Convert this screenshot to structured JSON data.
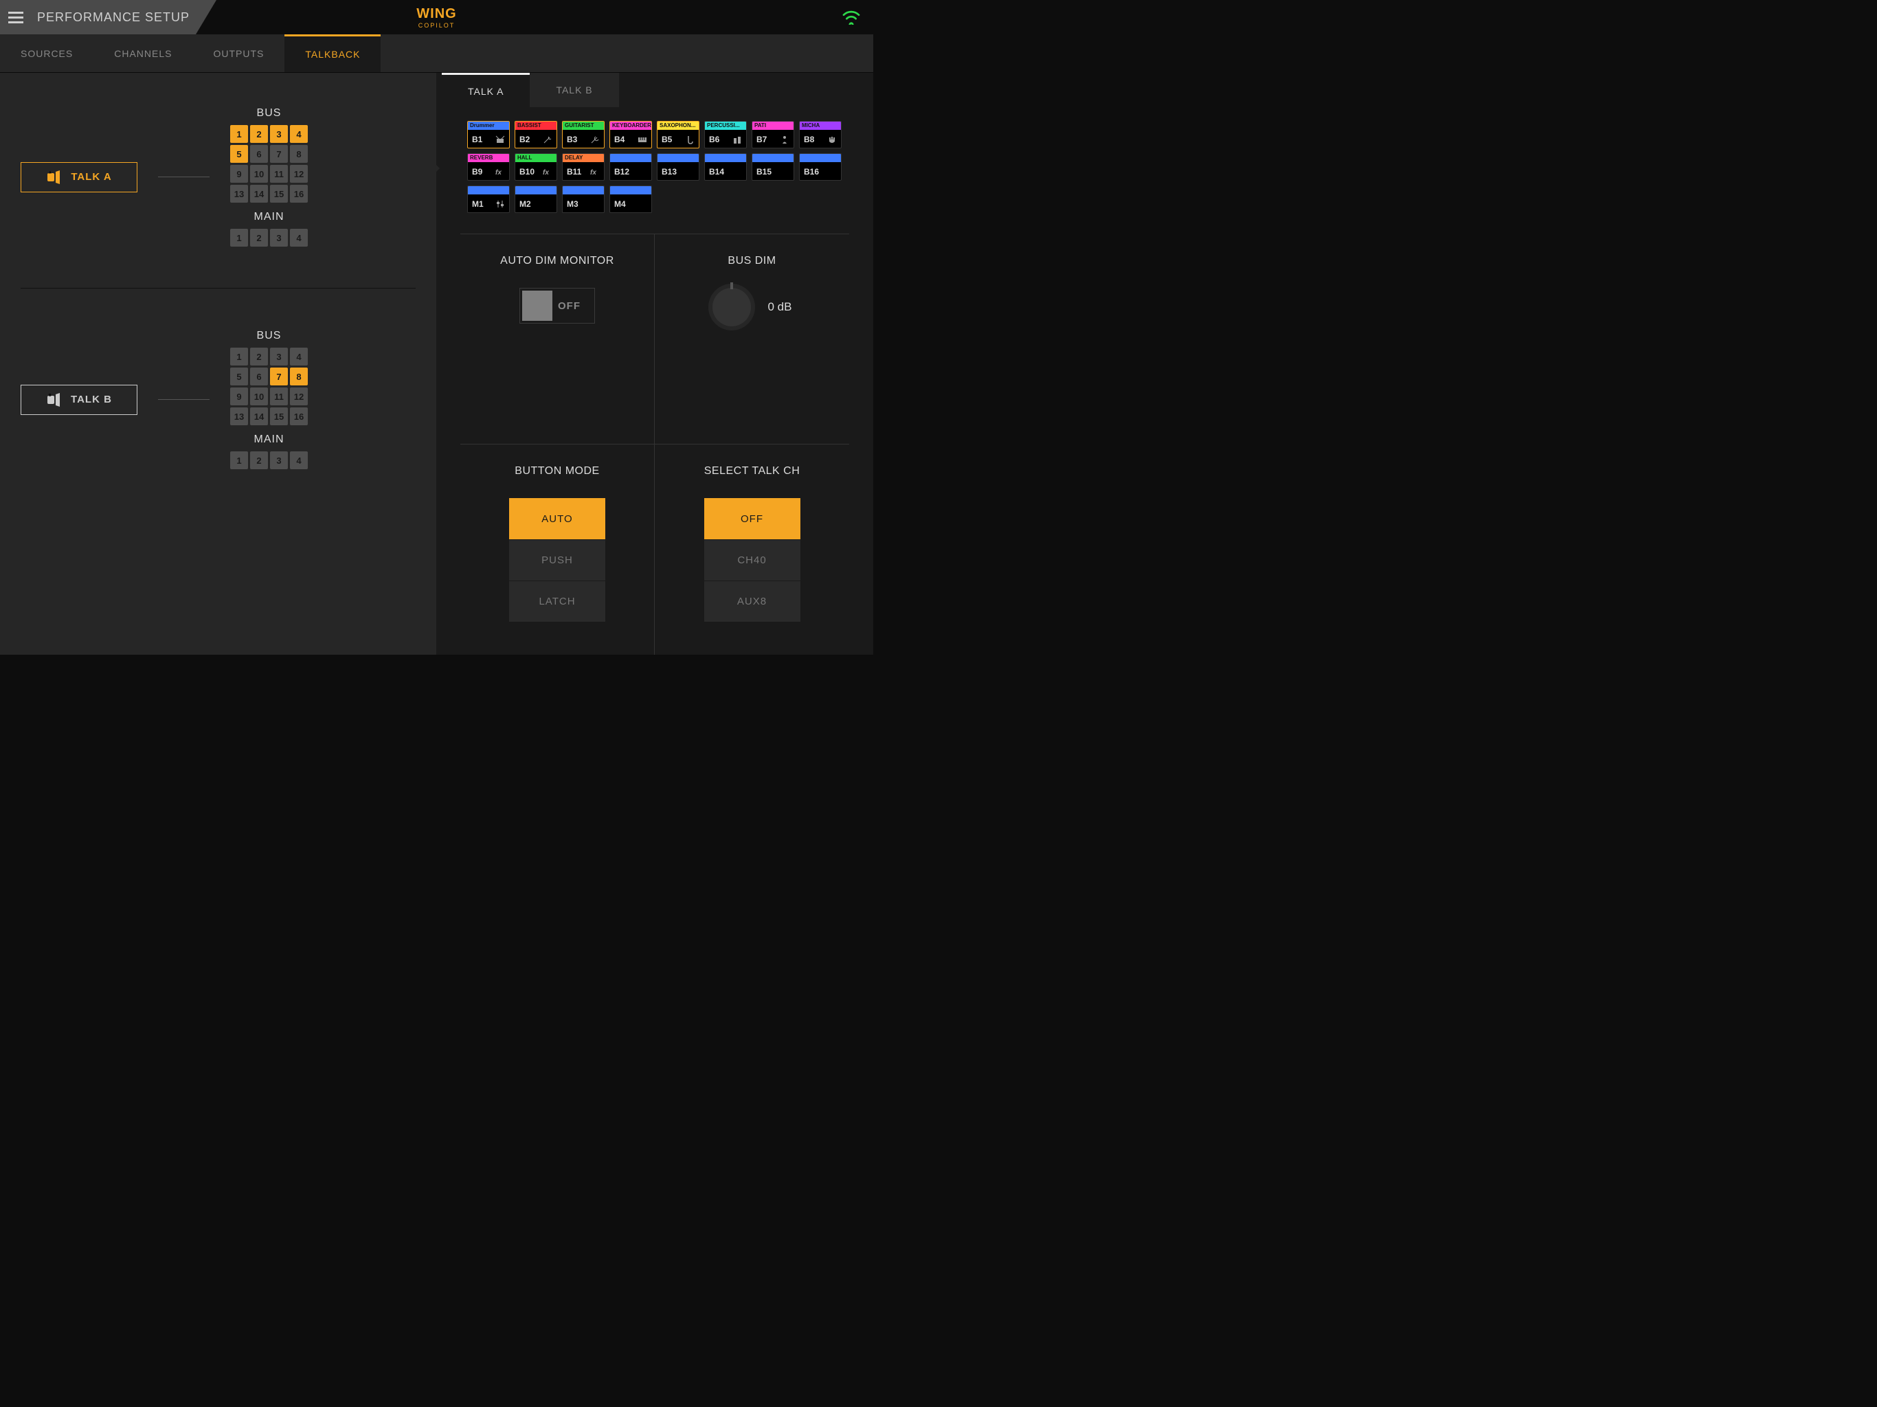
{
  "header": {
    "title": "PERFORMANCE SETUP",
    "brand_main": "WING",
    "brand_sub": "COPILOT"
  },
  "tabs": [
    "SOURCES",
    "CHANNELS",
    "OUTPUTS",
    "TALKBACK"
  ],
  "active_tab": 3,
  "talk_a": {
    "label": "TALK A",
    "bus_label": "BUS",
    "main_label": "MAIN",
    "bus_selected": [
      1,
      2,
      3,
      4,
      5
    ],
    "main_selected": []
  },
  "talk_b": {
    "label": "TALK B",
    "bus_label": "BUS",
    "main_label": "MAIN",
    "bus_selected": [
      7,
      8
    ],
    "main_selected": []
  },
  "right_tabs": [
    "TALK A",
    "TALK B"
  ],
  "right_active": 0,
  "buses": [
    {
      "id": "B1",
      "name": "Drummer",
      "color": "#3f7cff",
      "sel": true,
      "icon": "drum"
    },
    {
      "id": "B2",
      "name": "BASSIST",
      "color": "#ff2d3a",
      "sel": true,
      "icon": "bass"
    },
    {
      "id": "B3",
      "name": "GUITARIST",
      "color": "#2dd84a",
      "sel": true,
      "icon": "guitar"
    },
    {
      "id": "B4",
      "name": "KEYBOARDER",
      "color": "#ff3ecf",
      "sel": true,
      "icon": "keys"
    },
    {
      "id": "B5",
      "name": "SAXOPHON...",
      "color": "#ffe23a",
      "sel": true,
      "icon": "sax"
    },
    {
      "id": "B6",
      "name": "PERCUSSI...",
      "color": "#2de0d8",
      "sel": false,
      "icon": "perc"
    },
    {
      "id": "B7",
      "name": "PATI",
      "color": "#ff3ecf",
      "sel": false,
      "icon": "voc"
    },
    {
      "id": "B8",
      "name": "MICHA",
      "color": "#a23eff",
      "sel": false,
      "icon": "rock"
    },
    {
      "id": "B9",
      "name": "REVERB",
      "color": "#ff3ecf",
      "sel": false,
      "icon": "fx"
    },
    {
      "id": "B10",
      "name": "HALL",
      "color": "#2dd84a",
      "sel": false,
      "icon": "fx"
    },
    {
      "id": "B11",
      "name": "DELAY",
      "color": "#ff7a3a",
      "sel": false,
      "icon": "fx"
    },
    {
      "id": "B12",
      "name": "",
      "color": "#3f7cff",
      "sel": false,
      "icon": ""
    },
    {
      "id": "B13",
      "name": "",
      "color": "#3f7cff",
      "sel": false,
      "icon": ""
    },
    {
      "id": "B14",
      "name": "",
      "color": "#3f7cff",
      "sel": false,
      "icon": ""
    },
    {
      "id": "B15",
      "name": "",
      "color": "#3f7cff",
      "sel": false,
      "icon": ""
    },
    {
      "id": "B16",
      "name": "",
      "color": "#3f7cff",
      "sel": false,
      "icon": ""
    }
  ],
  "mains": [
    {
      "id": "M1",
      "name": "",
      "color": "#3f7cff",
      "icon": "fader"
    },
    {
      "id": "M2",
      "name": "",
      "color": "#3f7cff",
      "icon": ""
    },
    {
      "id": "M3",
      "name": "",
      "color": "#3f7cff",
      "icon": ""
    },
    {
      "id": "M4",
      "name": "",
      "color": "#3f7cff",
      "icon": ""
    }
  ],
  "auto_dim": {
    "title": "AUTO DIM MONITOR",
    "state": "OFF"
  },
  "bus_dim": {
    "title": "BUS DIM",
    "value": "0 dB"
  },
  "button_mode": {
    "title": "BUTTON MODE",
    "options": [
      "AUTO",
      "PUSH",
      "LATCH"
    ],
    "selected": 0
  },
  "select_talk": {
    "title": "SELECT TALK CH",
    "options": [
      "OFF",
      "CH40",
      "AUX8"
    ],
    "selected": 0
  }
}
